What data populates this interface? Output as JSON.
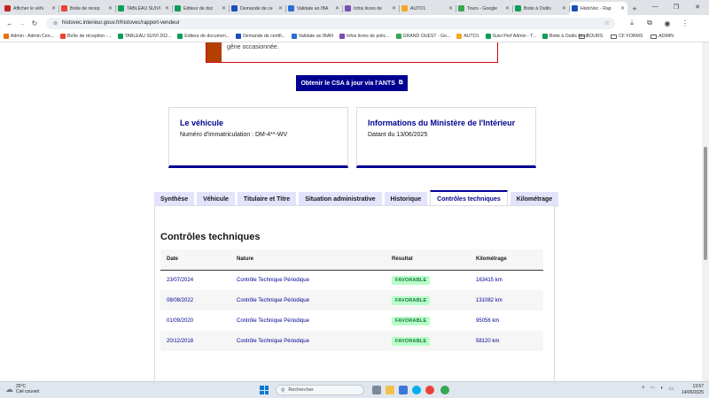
{
  "browser": {
    "tabs": [
      {
        "label": "Afficher le véhi",
        "color": "#c5221f",
        "active": false
      },
      {
        "label": "Boite de récep",
        "color": "#ea4335",
        "active": false
      },
      {
        "label": "TABLEAU SUIVI",
        "color": "#0f9d58",
        "active": false
      },
      {
        "label": "Editeur de doc",
        "color": "#0f9d58",
        "active": false
      },
      {
        "label": "Demande de ce",
        "color": "#1a4fba",
        "active": false
      },
      {
        "label": "Validate an IBA",
        "color": "#2c6dd5",
        "active": false
      },
      {
        "label": "Infos livres de",
        "color": "#7b4fb5",
        "active": false
      },
      {
        "label": "AUTO1",
        "color": "#f5a623",
        "active": false
      },
      {
        "label": "Tours - Google",
        "color": "#34a853",
        "active": false
      },
      {
        "label": "Boite à Outils",
        "color": "#0f9d58",
        "active": false
      },
      {
        "label": "HistoVec - Rap",
        "color": "#1a4fba",
        "active": true
      }
    ],
    "new_tab_label": "+",
    "url": "histovec.interieur.gouv.fr/histovec/rapport-vendeur",
    "bookmarks": [
      {
        "label": "Admin - Admin Cen...",
        "color": "#e8710a"
      },
      {
        "label": "Boîte de réception -...",
        "color": "#ea4335"
      },
      {
        "label": "TABLEAU SUIVI 202...",
        "color": "#0f9d58"
      },
      {
        "label": "Editeur de documen...",
        "color": "#0f9d58"
      },
      {
        "label": "Demande de certifi...",
        "color": "#1a4fba"
      },
      {
        "label": "Validate an IBAN",
        "color": "#2c6dd5"
      },
      {
        "label": "Infos livres de polic...",
        "color": "#7b4fb5"
      },
      {
        "label": "GRAND OUEST - Go...",
        "color": "#34a853"
      },
      {
        "label": "AUTO1",
        "color": "#f5a623"
      },
      {
        "label": "Suivi Perf Admin - T...",
        "color": "#0f9d58"
      },
      {
        "label": "Boite à Outils Nord...",
        "color": "#0f9d58"
      }
    ],
    "bookmark_folders": [
      "TOURS",
      "CF FORMS",
      "ADMIN"
    ]
  },
  "alert": {
    "text": "situation administrative disponible sur le site de l'ANTS fait foi. Veuillez nous excuser pour la gêne occasionnée."
  },
  "csa_button": {
    "label": "Obtenir le CSA à jour via l'ANTS",
    "icon": "external-link-icon"
  },
  "cards": {
    "vehicle": {
      "title": "Le véhicule",
      "text": "Numéro d'immatriculation : DM-4**-WV"
    },
    "ministry": {
      "title": "Informations du Ministère de l'Intérieur",
      "text": "Datant du 13/06/2025"
    }
  },
  "report_tabs": [
    "Synthèse",
    "Véhicule",
    "Titulaire et Titre",
    "Situation administrative",
    "Historique",
    "Contrôles techniques",
    "Kilométrage"
  ],
  "selected_tab": "Contrôles techniques",
  "controls": {
    "title": "Contrôles techniques",
    "headers": [
      "Date",
      "Nature",
      "Résultat",
      "Kilométrage"
    ],
    "rows": [
      {
        "date": "23/07/2024",
        "nature": "Contrôle Technique Périodique",
        "result": "FAVORABLE",
        "km": "163415 km"
      },
      {
        "date": "08/08/2022",
        "nature": "Contrôle Technique Périodique",
        "result": "FAVORABLE",
        "km": "131082 km"
      },
      {
        "date": "01/09/2020",
        "nature": "Contrôle Technique Périodique",
        "result": "FAVORABLE",
        "km": "95056 km"
      },
      {
        "date": "20/12/2018",
        "nature": "Contrôle Technique Périodique",
        "result": "FAVORABLE",
        "km": "58120 km"
      }
    ]
  },
  "taskbar": {
    "weather_temp": "25°C",
    "weather_desc": "Ciel couvert",
    "search_placeholder": "Rechercher",
    "time": "13:57",
    "date": "14/06/2025"
  },
  "colors": {
    "accent": "#000091",
    "favorable_bg": "#b8fec9",
    "favorable_text": "#18753c",
    "alert_border": "#ce0500"
  }
}
